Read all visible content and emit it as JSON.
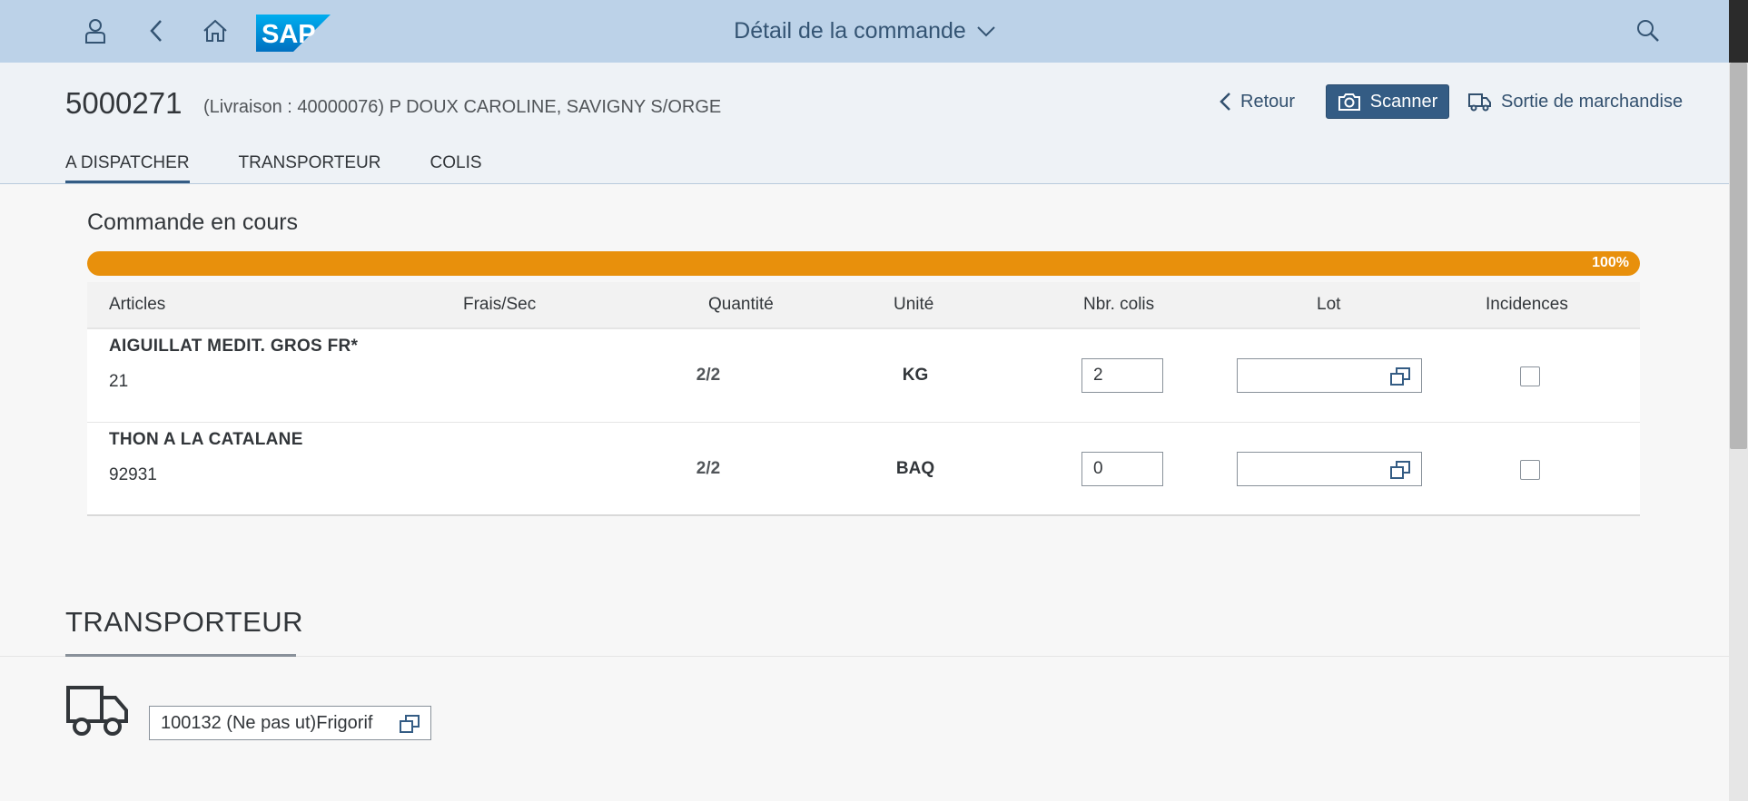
{
  "shell": {
    "title": "Détail de la commande",
    "icons": [
      "user-icon",
      "back-icon",
      "home-icon",
      "search-icon"
    ],
    "logo_text": "SAP"
  },
  "header": {
    "object_id": "5000271",
    "subtitle": "(Livraison : 40000076) P DOUX CAROLINE, SAVIGNY S/ORGE",
    "back_label": "Retour",
    "scan_label": "Scanner",
    "goods_issue_label": "Sortie de marchandise"
  },
  "tabs": [
    "A DISPATCHER",
    "TRANSPORTEUR",
    "COLIS"
  ],
  "dispatch": {
    "title": "Commande en cours",
    "progress_label": "100%",
    "progress": 1.0,
    "columns": [
      "Articles",
      "Frais/Sec",
      "Quantité",
      "Unité",
      "Nbr. colis",
      "Lot",
      "Incidences"
    ],
    "rows": [
      {
        "name": "AIGUILLAT MEDIT. GROS FR*",
        "code": "21",
        "quantity": "2/2",
        "unit": "KG",
        "packages": "2",
        "lot": "",
        "incident": false
      },
      {
        "name": "THON A LA CATALANE",
        "code": "92931",
        "quantity": "2/2",
        "unit": "BAQ",
        "packages": "0",
        "lot": "",
        "incident": false
      }
    ]
  },
  "carrier": {
    "title": "TRANSPORTEUR",
    "value": "100132 (Ne pas ut)Frigorif"
  },
  "colors": {
    "shell_bg": "#bcd2e8",
    "accent": "#345c84",
    "progress": "#e8900c"
  }
}
